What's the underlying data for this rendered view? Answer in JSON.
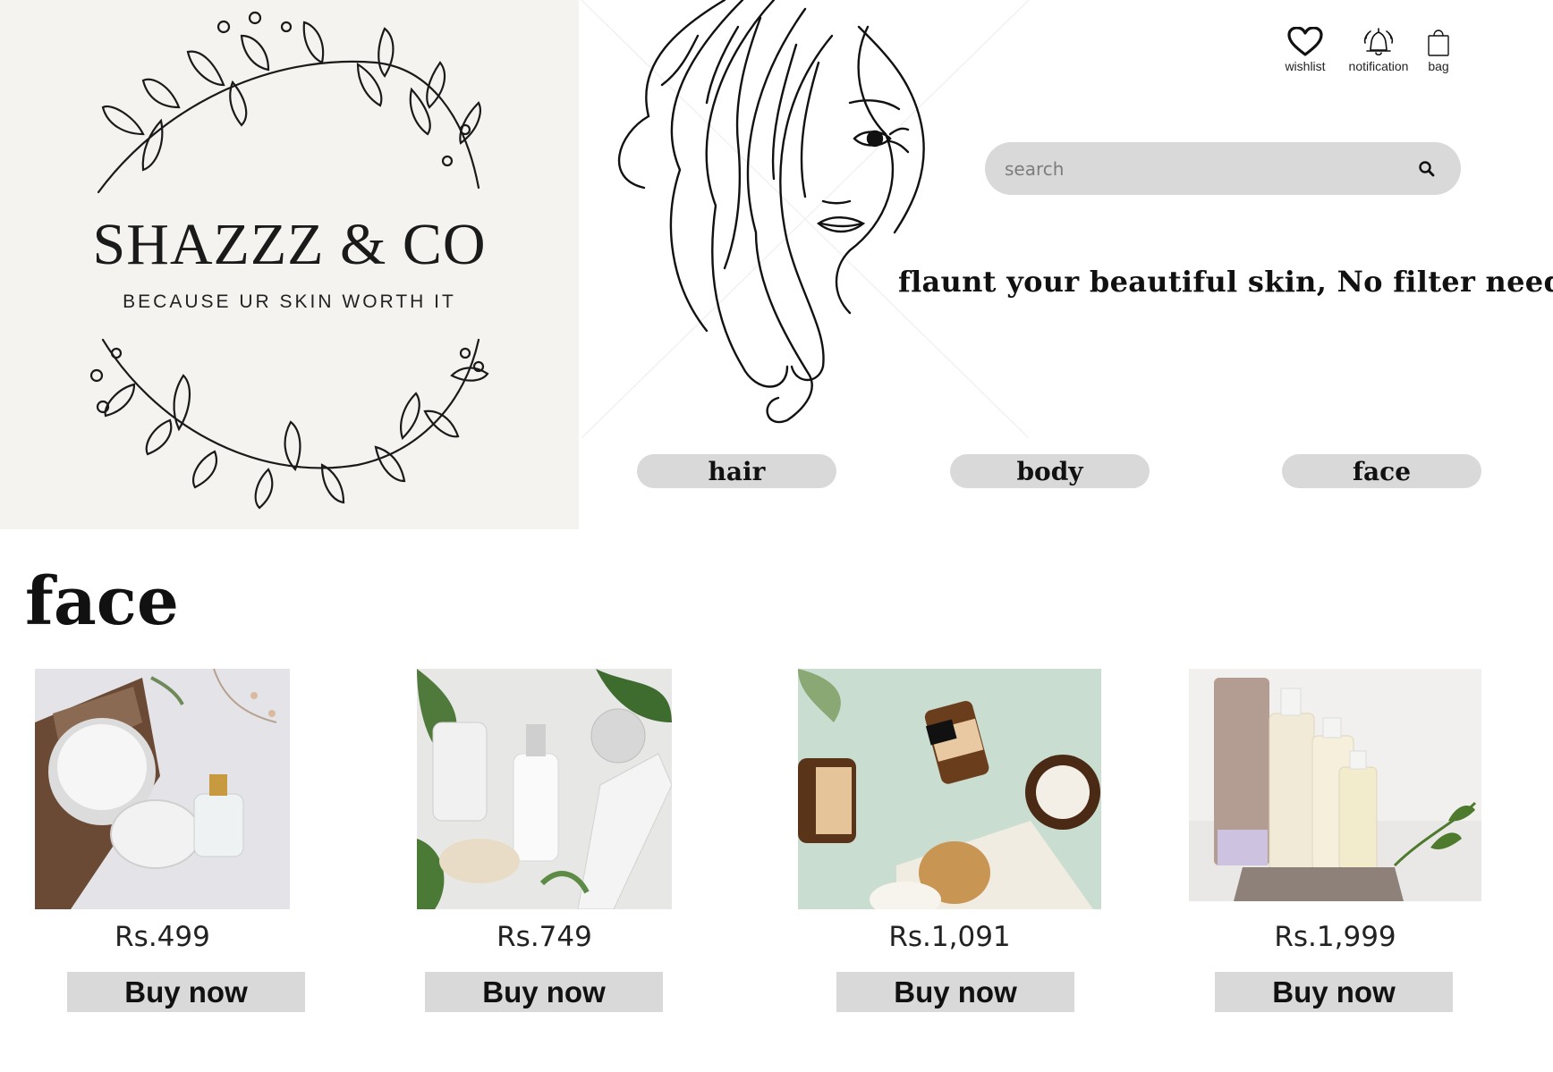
{
  "brand": {
    "name": "SHAZZZ & CO",
    "tagline": "BECAUSE UR SKIN WORTH IT"
  },
  "header": {
    "icons": [
      {
        "icon": "heart-icon",
        "label": "wishlist"
      },
      {
        "icon": "bell-icon",
        "label": "notification"
      },
      {
        "icon": "bag-icon",
        "label": "bag"
      }
    ]
  },
  "search": {
    "placeholder": "search",
    "value": ""
  },
  "hero": {
    "slogan": "flaunt your beautiful skin, No filter needed"
  },
  "categories": [
    {
      "label": "hair"
    },
    {
      "label": "body"
    },
    {
      "label": "face"
    }
  ],
  "section": {
    "title": "face"
  },
  "products": [
    {
      "price": "Rs.499",
      "buy_label": "Buy now",
      "image": "cream-jar-serum-bark"
    },
    {
      "price": "Rs.749",
      "buy_label": "Buy now",
      "image": "white-dropper-bottles-leaves"
    },
    {
      "price": "Rs.1,091",
      "buy_label": "Buy now",
      "image": "amber-bottles-mint-background"
    },
    {
      "price": "Rs.1,999",
      "buy_label": "Buy now",
      "image": "pump-bottles-with-tube"
    }
  ],
  "colors": {
    "logo_bg": "#f4f3ef",
    "button_gray": "#d9d9d9",
    "text": "#111111"
  }
}
